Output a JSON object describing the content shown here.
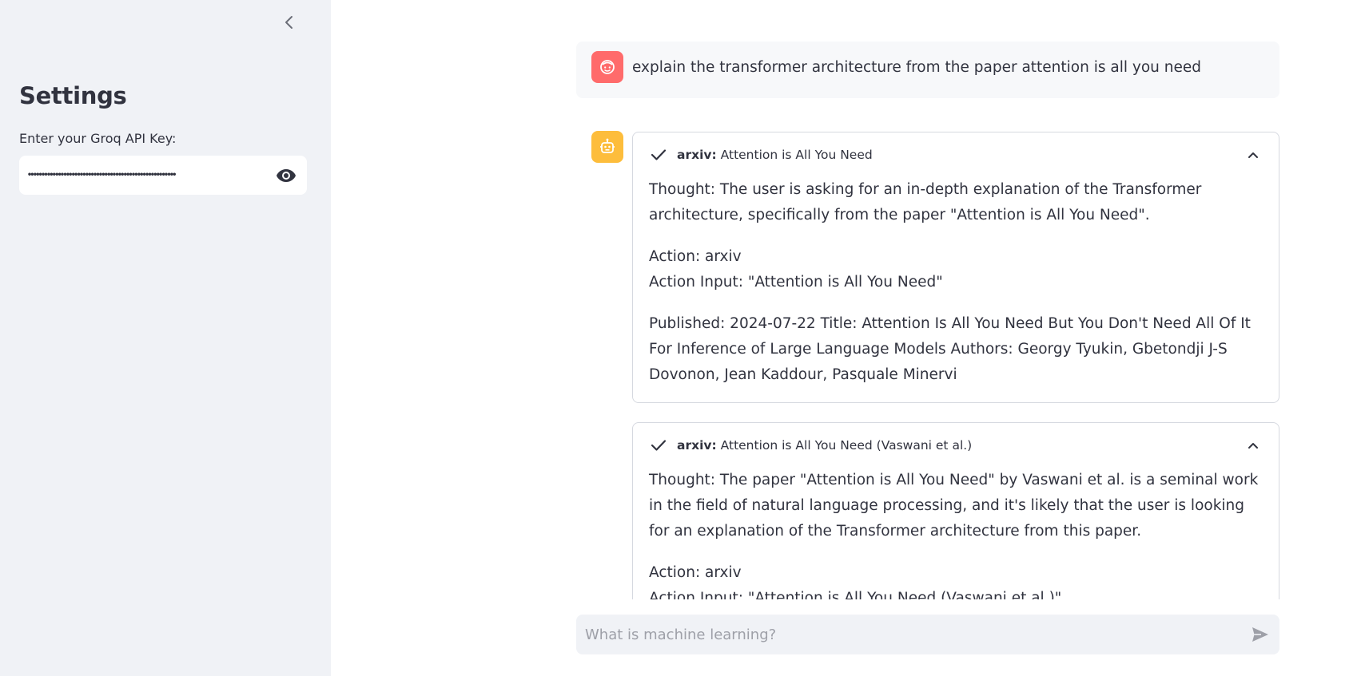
{
  "sidebar": {
    "title": "Settings",
    "api_label": "Enter your Groq API Key:",
    "api_value_masked": "••••••••••••••••••••••••••••••••••••••••••••••••••••••",
    "icons": {
      "collapse": "chevron-left-icon",
      "reveal": "eye-icon"
    }
  },
  "chat": {
    "user_message": "explain the transformer architecture from the paper attention is all you need",
    "expanders": [
      {
        "tool": "arxiv:",
        "title": "Attention is All You Need",
        "paragraphs": [
          "Thought: The user is asking for an in-depth explanation of the Transformer architecture, specifically from the paper \"Attention is All You Need\".",
          "Action: arxiv",
          "Action Input: \"Attention is All You Need\"",
          "Published: 2024-07-22 Title: Attention Is All You Need But You Don't Need All Of It For Inference of Large Language Models Authors: Georgy Tyukin, Gbetondji J-S Dovonon, Jean Kaddour, Pasquale Minervi"
        ]
      },
      {
        "tool": "arxiv:",
        "title": "Attention is All You Need (Vaswani et al.)",
        "paragraphs": [
          "Thought: The paper \"Attention is All You Need\" by Vaswani et al. is a seminal work in the field of natural language processing, and it's likely that the user is looking for an explanation of the Transformer architecture from this paper.",
          "Action: arxiv",
          "Action Input: \"Attention is All You Need (Vaswani et al.)\""
        ]
      }
    ],
    "input_placeholder": "What is machine learning?"
  },
  "colors": {
    "sidebar_bg": "#f0f2f6",
    "user_avatar": "#ff6b6b",
    "bot_avatar": "#fdbd3c",
    "text": "#31333f"
  }
}
